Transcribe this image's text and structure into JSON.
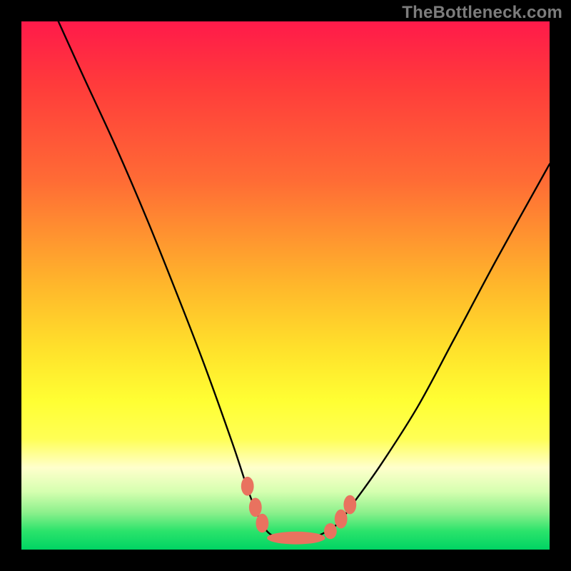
{
  "watermark": "TheBottleneck.com",
  "chart_data": {
    "type": "line",
    "title": "",
    "xlabel": "",
    "ylabel": "",
    "xlim": [
      0,
      100
    ],
    "ylim": [
      0,
      100
    ],
    "grid": false,
    "legend": false,
    "series": [
      {
        "name": "bottleneck-curve",
        "x": [
          7,
          12,
          18,
          24,
          30,
          35,
          40,
          43,
          45,
          47,
          50,
          54,
          57,
          60,
          63,
          68,
          75,
          82,
          90,
          100
        ],
        "values": [
          100,
          89,
          76,
          62,
          47,
          34,
          20,
          11,
          6,
          3,
          2,
          2,
          3,
          5,
          9,
          16,
          27,
          40,
          55,
          73
        ],
        "color": "#000000"
      }
    ],
    "markers": [
      {
        "name": "left-dot-1",
        "x": 42.8,
        "y": 12.0,
        "rx": 1.2,
        "ry": 1.8,
        "color": "#e9725f"
      },
      {
        "name": "left-dot-2",
        "x": 44.3,
        "y": 8.0,
        "rx": 1.2,
        "ry": 1.8,
        "color": "#e9725f"
      },
      {
        "name": "left-dot-3",
        "x": 45.6,
        "y": 5.0,
        "rx": 1.2,
        "ry": 1.8,
        "color": "#e9725f"
      },
      {
        "name": "base-pill",
        "x": 52.0,
        "y": 2.2,
        "rx": 5.5,
        "ry": 1.2,
        "color": "#e9725f"
      },
      {
        "name": "right-dot-1",
        "x": 58.5,
        "y": 3.5,
        "rx": 1.2,
        "ry": 1.5,
        "color": "#e9725f"
      },
      {
        "name": "right-dot-2",
        "x": 60.5,
        "y": 5.8,
        "rx": 1.2,
        "ry": 1.8,
        "color": "#e9725f"
      },
      {
        "name": "right-dot-3",
        "x": 62.2,
        "y": 8.5,
        "rx": 1.2,
        "ry": 1.8,
        "color": "#e9725f"
      }
    ],
    "gradient_stops": [
      {
        "pos": 0,
        "color": "#ff1a4a"
      },
      {
        "pos": 12,
        "color": "#ff3b3b"
      },
      {
        "pos": 30,
        "color": "#ff6b35"
      },
      {
        "pos": 50,
        "color": "#ffb72b"
      },
      {
        "pos": 62,
        "color": "#ffe12b"
      },
      {
        "pos": 72,
        "color": "#ffff33"
      },
      {
        "pos": 79,
        "color": "#ffff55"
      },
      {
        "pos": 84.5,
        "color": "#ffffcc"
      },
      {
        "pos": 89,
        "color": "#d6ffb0"
      },
      {
        "pos": 93,
        "color": "#8cf08c"
      },
      {
        "pos": 96.5,
        "color": "#2be36b"
      },
      {
        "pos": 100,
        "color": "#00d463"
      }
    ]
  }
}
